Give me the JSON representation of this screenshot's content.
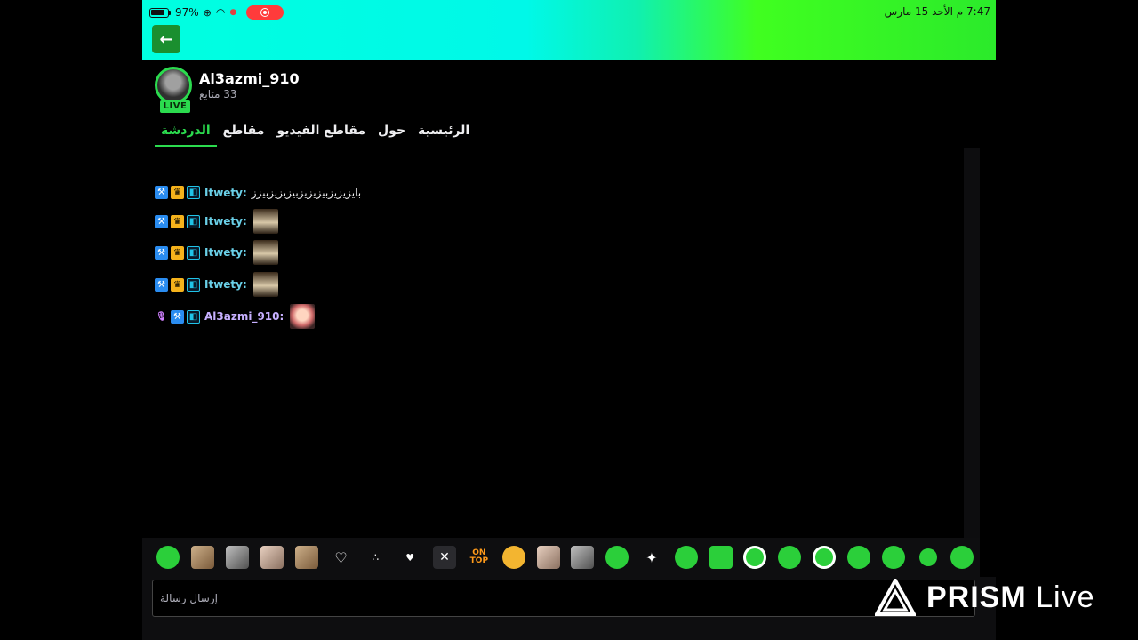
{
  "status_bar": {
    "battery": "97%",
    "time_date": "7:47 م  الأحد 15 مارس"
  },
  "channel": {
    "name": "Al3azmi_910",
    "followers": "33 متابع",
    "live_label": "LIVE"
  },
  "tabs": [
    {
      "label": "الرئيسية"
    },
    {
      "label": "حول"
    },
    {
      "label": "مقاطع الفيديو"
    },
    {
      "label": "مقاطع"
    },
    {
      "label": "الدردشة",
      "active": true
    }
  ],
  "chat": {
    "messages": [
      {
        "user": "Itwety:",
        "text": "بايزيزيزبيزيزيزبيزيزيزبيزز"
      },
      {
        "user": "Itwety:",
        "text": ""
      },
      {
        "user": "Itwety:",
        "text": ""
      },
      {
        "user": "Itwety:",
        "text": ""
      },
      {
        "user": "Al3azmi_910:",
        "text": ""
      }
    ]
  },
  "emote_bar": {
    "ontop_text": "ON TOP"
  },
  "input": {
    "placeholder": "إرسال رسالة"
  },
  "watermark": {
    "brand": "PRISM",
    "suffix": "Live"
  },
  "colors": {
    "accent": "#2bdb4e",
    "back_button": "#1a8f2f",
    "record_pill": "#ff3b3b"
  }
}
